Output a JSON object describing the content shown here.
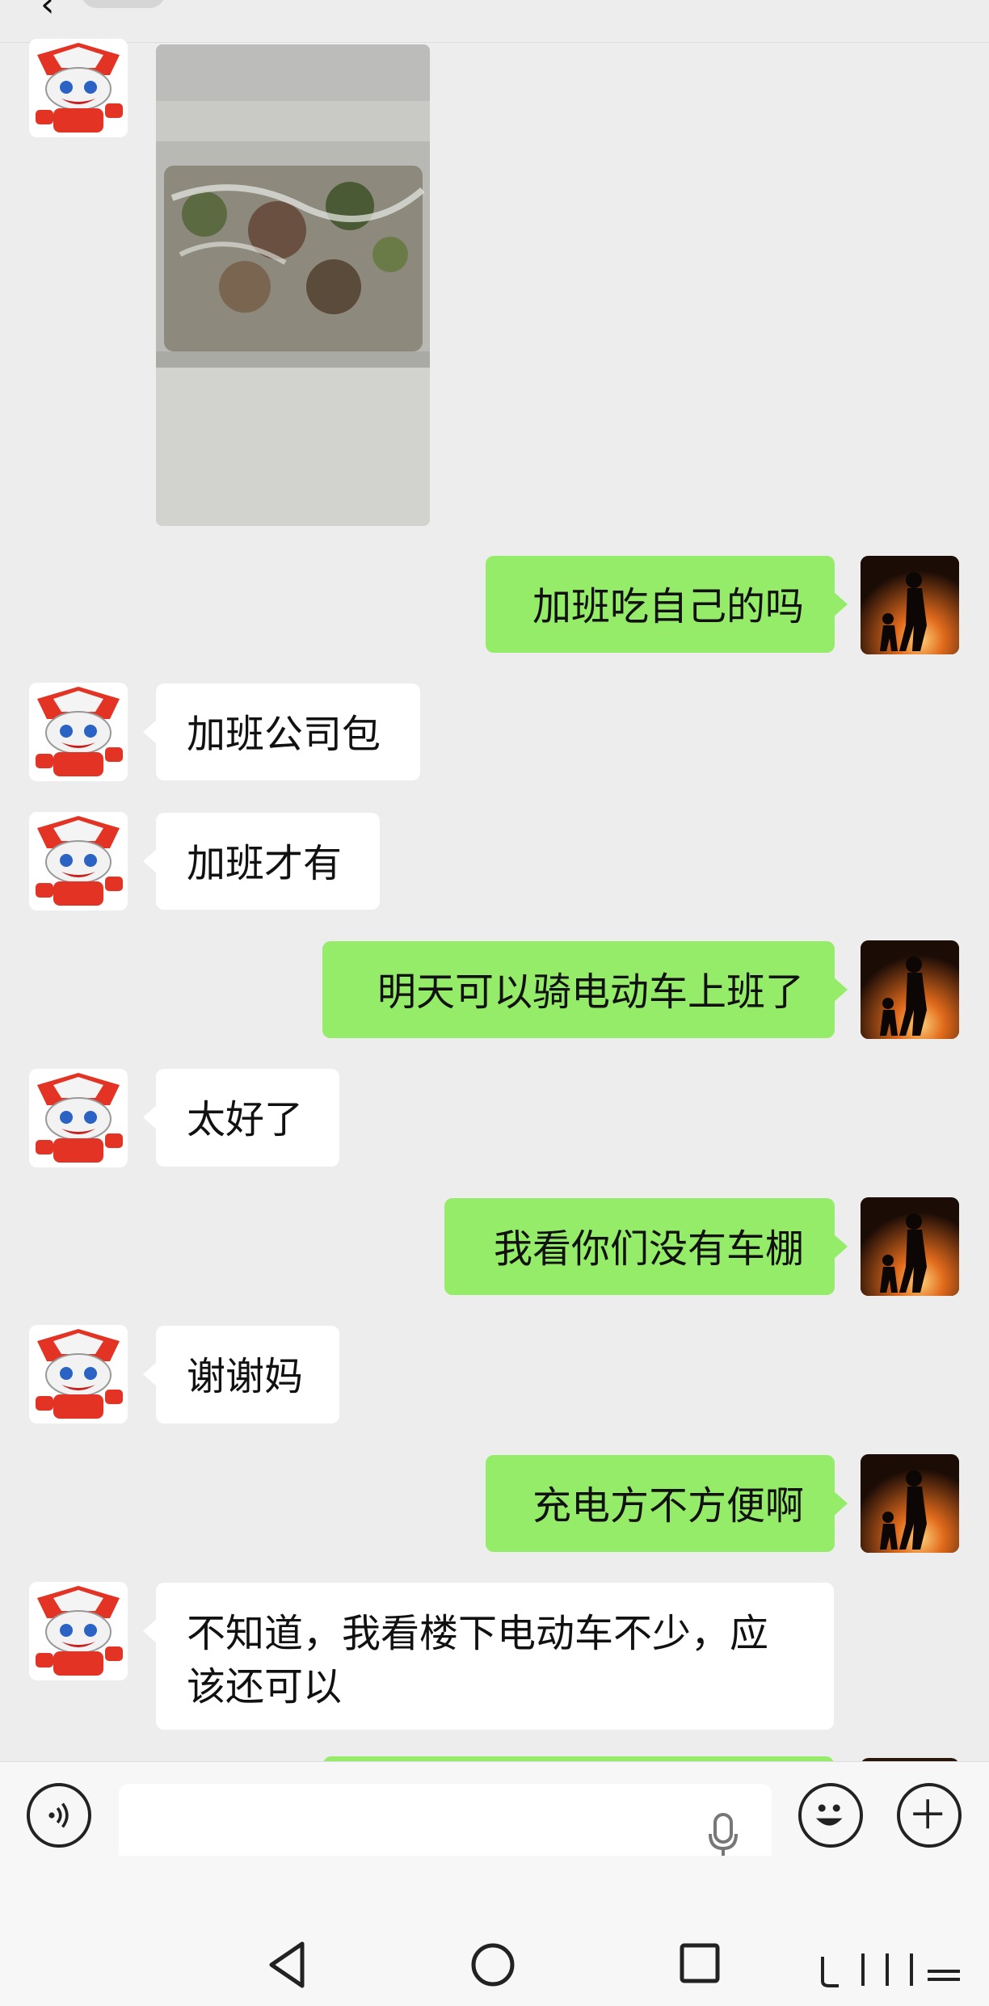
{
  "header": {
    "back_glyph": "‹",
    "title": ""
  },
  "messages": [
    {
      "side": "in",
      "type": "image",
      "avatar_icon": "robot-avatar-icon",
      "description": "photo"
    },
    {
      "side": "out",
      "type": "text",
      "avatar_icon": "sunset-avatar-icon",
      "text": "加班吃自己的吗"
    },
    {
      "side": "in",
      "type": "text",
      "avatar_icon": "robot-avatar-icon",
      "text": "加班公司包"
    },
    {
      "side": "in",
      "type": "text",
      "avatar_icon": "robot-avatar-icon",
      "text": "加班才有"
    },
    {
      "side": "out",
      "type": "text",
      "avatar_icon": "sunset-avatar-icon",
      "text": "明天可以骑电动车上班了"
    },
    {
      "side": "in",
      "type": "text",
      "avatar_icon": "robot-avatar-icon",
      "text": "太好了"
    },
    {
      "side": "out",
      "type": "text",
      "avatar_icon": "sunset-avatar-icon",
      "text": "我看你们没有车棚"
    },
    {
      "side": "in",
      "type": "text",
      "avatar_icon": "robot-avatar-icon",
      "text": "谢谢妈"
    },
    {
      "side": "out",
      "type": "text",
      "avatar_icon": "sunset-avatar-icon",
      "text": "充电方不方便啊"
    },
    {
      "side": "in",
      "type": "text",
      "avatar_icon": "robot-avatar-icon",
      "text": "不知道，我看楼下电动车不少，应该还可以"
    }
  ],
  "input_bar": {
    "voice_icon": "voice-icon",
    "message_value": "",
    "mic_icon": "mic-icon",
    "emoji_icon": "emoji-icon",
    "plus_icon": "plus-icon"
  },
  "nav_bar": {
    "back_icon": "nav-back-icon",
    "home_icon": "nav-home-icon",
    "recent_icon": "nav-recent-icon",
    "keyboard_icon": "keyboard-switch-icon"
  },
  "colors": {
    "background": "#ededed",
    "outgoing_bubble": "#95ec69",
    "incoming_bubble": "#ffffff",
    "text": "#111111"
  }
}
